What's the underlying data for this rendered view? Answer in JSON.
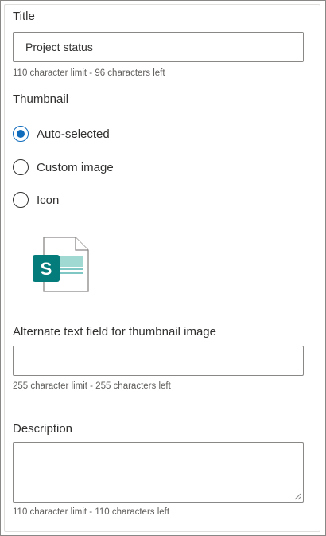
{
  "title_section": {
    "label": "Title",
    "value": "Project status",
    "hint": "110 character limit - 96 characters left"
  },
  "thumbnail_section": {
    "label": "Thumbnail",
    "options": [
      {
        "label": "Auto-selected",
        "selected": true
      },
      {
        "label": "Custom image",
        "selected": false
      },
      {
        "label": "Icon",
        "selected": false
      }
    ],
    "preview_icon": "sharepoint-file-icon",
    "icon_letter": "S",
    "accent": "#037c7b"
  },
  "alt_text_section": {
    "label": "Alternate text field for thumbnail image",
    "value": "",
    "hint": "255 character limit - 255 characters left"
  },
  "description_section": {
    "label": "Description",
    "value": "",
    "hint": "110 character limit - 110 characters left"
  }
}
